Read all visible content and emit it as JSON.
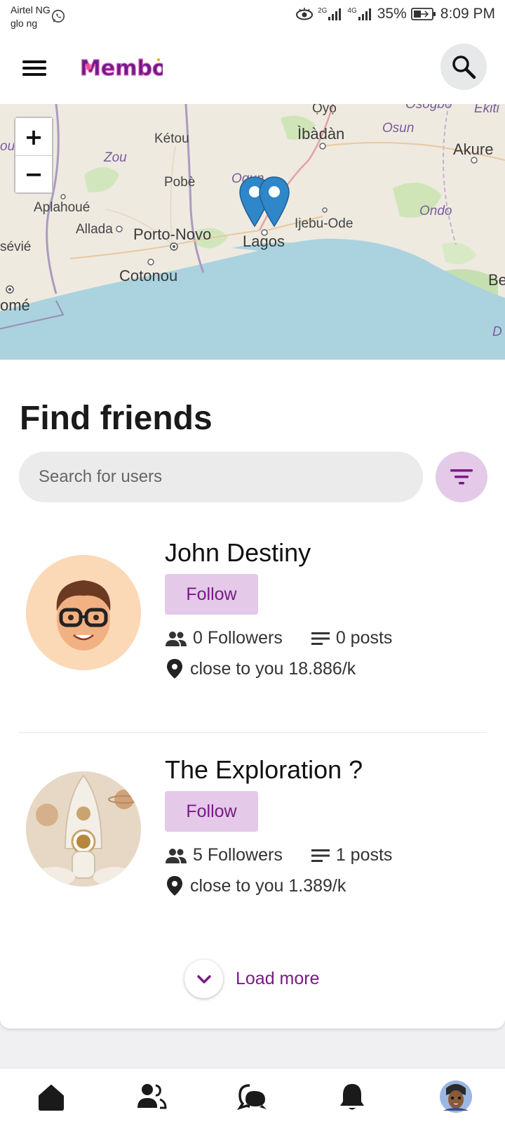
{
  "status_bar": {
    "carrier_1": "Airtel NG",
    "carrier_2": "glo ng",
    "network_1": "2G",
    "network_2": "4G",
    "battery": "35%",
    "time": "8:09 PM"
  },
  "header": {
    "logo_text": "Membo"
  },
  "map": {
    "zoom_in": "+",
    "zoom_out": "−",
    "labels": {
      "oyo": "Ọ̀yọ́",
      "ibadan": "Ìbàdàn",
      "osun": "Osun",
      "osogbo": "Osogbo",
      "ekiti": "Ekiti",
      "akure": "Akure",
      "ketou": "Kétou",
      "zou": "Zou",
      "pobe": "Pobè",
      "ogun": "Ogun",
      "aplahoue": "Aplahoué",
      "allada": "Allada",
      "porto_novo": "Porto-Novo",
      "lagos": "Lagos",
      "ijebu_ode": "Ijebu-Ode",
      "ondo": "Ondo",
      "cotonou": "Cotonou",
      "sevie": "sévié",
      "ome": "omé",
      "be": "Be",
      "d": "D",
      "ou": "ou"
    }
  },
  "find_friends": {
    "title": "Find friends",
    "search_placeholder": "Search for users",
    "users": [
      {
        "name": "John Destiny",
        "follow_label": "Follow",
        "followers": "0 Followers",
        "posts": "0 posts",
        "distance": "close to you 18.886/k"
      },
      {
        "name": "The Exploration ?",
        "follow_label": "Follow",
        "followers": "5 Followers",
        "posts": "1 posts",
        "distance": "close to you 1.389/k"
      }
    ],
    "load_more": "Load more"
  },
  "colors": {
    "accent": "#7a1a86",
    "accent_light": "#e4c9e9",
    "water": "#aad3df",
    "land": "#eeeae0"
  },
  "bottom_nav": {
    "items": [
      "home-icon",
      "friends-icon",
      "chat-icon",
      "bell-icon",
      "profile-avatar"
    ]
  }
}
